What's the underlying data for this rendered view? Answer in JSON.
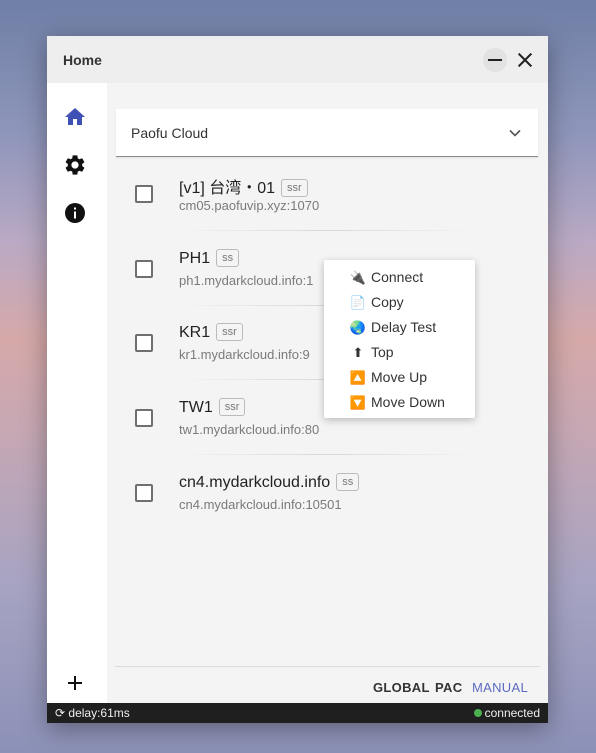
{
  "window": {
    "title": "Home"
  },
  "sidebar": {
    "items": [
      {
        "name": "home",
        "icon": "home-icon"
      },
      {
        "name": "settings",
        "icon": "gear-icon"
      },
      {
        "name": "about",
        "icon": "info-icon"
      }
    ],
    "add_icon": "plus-icon"
  },
  "profile_select": {
    "value": "Paofu Cloud"
  },
  "servers": [
    {
      "name": "[v1] 台湾・01",
      "type": "ssr",
      "address": "cm05.paofuvip.xyz:1070"
    },
    {
      "name": "PH1",
      "type": "ss",
      "address": "ph1.mydarkcloud.info:1"
    },
    {
      "name": "KR1",
      "type": "ssr",
      "address": "kr1.mydarkcloud.info:9"
    },
    {
      "name": "TW1",
      "type": "ssr",
      "address": "tw1.mydarkcloud.info:80"
    },
    {
      "name": "cn4.mydarkcloud.info",
      "type": "ss",
      "address": "cn4.mydarkcloud.info:10501"
    }
  ],
  "context_menu": {
    "items": [
      {
        "label": "Connect",
        "icon": "plug-icon",
        "glyph": "🔌"
      },
      {
        "label": "Copy",
        "icon": "clipboard-icon",
        "glyph": "📄"
      },
      {
        "label": "Delay Test",
        "icon": "globe-icon",
        "glyph": "🌏"
      },
      {
        "label": "Top",
        "icon": "top-arrow-icon",
        "glyph": "⬆"
      },
      {
        "label": "Move Up",
        "icon": "up-arrow-icon",
        "glyph": "🔼"
      },
      {
        "label": "Move Down",
        "icon": "down-arrow-icon",
        "glyph": "🔽"
      }
    ]
  },
  "modes": {
    "global": "GLOBAL",
    "pac": "PAC",
    "manual": "MANUAL",
    "active": "MANUAL"
  },
  "statusbar": {
    "delay": "delay:61ms",
    "status": "connected"
  },
  "colors": {
    "accent": "#5c6bc0",
    "home_icon": "#3f51b5",
    "status_ok": "#4caf50"
  }
}
